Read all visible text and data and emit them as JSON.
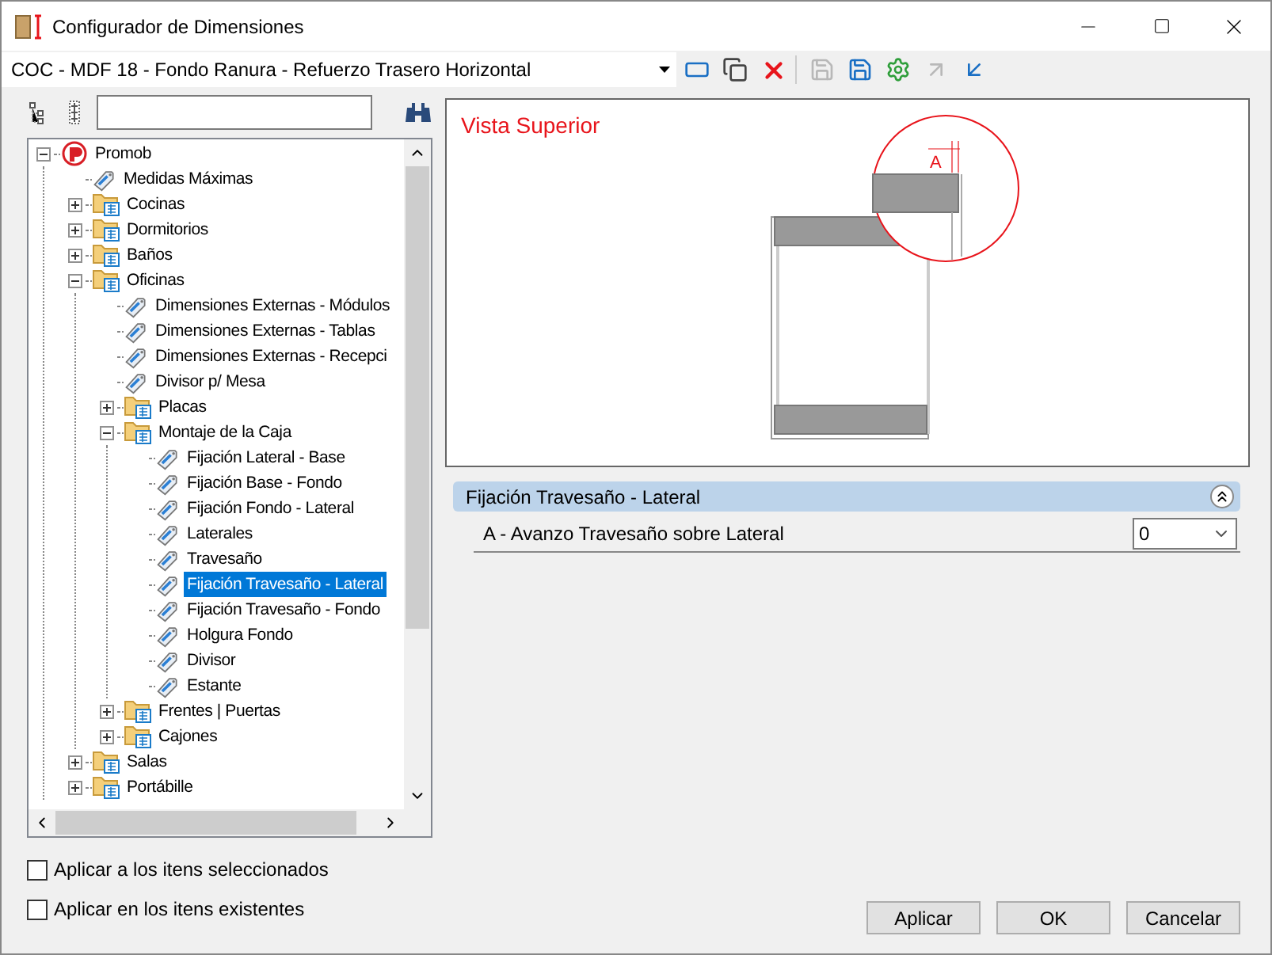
{
  "window": {
    "title": "Configurador de Dimensiones"
  },
  "toolbar": {
    "configuration": "COC - MDF 18 - Fondo Ranura - Refuerzo Trasero Horizontal",
    "buttons": [
      {
        "kind": "insert",
        "disabled": false
      },
      {
        "kind": "copy",
        "disabled": false
      },
      {
        "kind": "delete",
        "disabled": false
      },
      {
        "kind": "save",
        "disabled": true
      },
      {
        "kind": "save-as",
        "disabled": false
      },
      {
        "kind": "apply",
        "disabled": false
      },
      {
        "kind": "export",
        "disabled": true
      },
      {
        "kind": "import",
        "disabled": false
      }
    ]
  },
  "tree": [
    {
      "label": "Promob",
      "kind": "root",
      "expanded": true,
      "selected": false,
      "children": [
        {
          "label": "Medidas Máximas",
          "kind": "leaf",
          "selected": false
        },
        {
          "label": "Cocinas",
          "kind": "folder",
          "expanded": false,
          "selected": false
        },
        {
          "label": "Dormitorios",
          "kind": "folder",
          "expanded": false,
          "selected": false
        },
        {
          "label": "Baños",
          "kind": "folder",
          "expanded": false,
          "selected": false
        },
        {
          "label": "Oficinas",
          "kind": "folder",
          "expanded": true,
          "selected": false,
          "children": [
            {
              "label": "Dimensiones Externas - Módulos",
              "kind": "leaf",
              "selected": false
            },
            {
              "label": "Dimensiones Externas - Tablas",
              "kind": "leaf",
              "selected": false
            },
            {
              "label": "Dimensiones Externas - Recepci",
              "kind": "leaf",
              "selected": false
            },
            {
              "label": "Divisor p/ Mesa",
              "kind": "leaf",
              "selected": false
            },
            {
              "label": "Placas",
              "kind": "folder",
              "expanded": false,
              "selected": false
            },
            {
              "label": "Montaje de la Caja",
              "kind": "folder",
              "expanded": true,
              "selected": false,
              "children": [
                {
                  "label": "Fijación Lateral - Base",
                  "kind": "leaf",
                  "selected": false
                },
                {
                  "label": "Fijación Base - Fondo",
                  "kind": "leaf",
                  "selected": false
                },
                {
                  "label": "Fijación Fondo - Lateral",
                  "kind": "leaf",
                  "selected": false
                },
                {
                  "label": "Laterales",
                  "kind": "leaf",
                  "selected": false
                },
                {
                  "label": "Travesaño",
                  "kind": "leaf",
                  "selected": false
                },
                {
                  "label": "Fijación Travesaño - Lateral",
                  "kind": "leaf",
                  "selected": true
                },
                {
                  "label": "Fijación Travesaño - Fondo",
                  "kind": "leaf",
                  "selected": false
                },
                {
                  "label": "Holgura Fondo",
                  "kind": "leaf",
                  "selected": false
                },
                {
                  "label": "Divisor",
                  "kind": "leaf",
                  "selected": false
                },
                {
                  "label": "Estante",
                  "kind": "leaf",
                  "selected": false
                }
              ]
            },
            {
              "label": "Frentes | Puertas",
              "kind": "folder",
              "expanded": false,
              "selected": false
            },
            {
              "label": "Cajones",
              "kind": "folder",
              "expanded": false,
              "selected": false
            }
          ]
        },
        {
          "label": "Salas",
          "kind": "folder",
          "expanded": false,
          "selected": false
        },
        {
          "label": "Portábille",
          "kind": "folder",
          "expanded": false,
          "selected": false
        }
      ]
    }
  ],
  "preview": {
    "title": "Vista Superior",
    "dimension_label": "A"
  },
  "properties": {
    "group": "Fijación Travesaño - Lateral",
    "expanded": true,
    "rows": [
      {
        "label": "A - Avanzo Travesaño sobre Lateral",
        "value": "0"
      }
    ]
  },
  "options": [
    {
      "label": "Aplicar a los itens seleccionados",
      "checked": false
    },
    {
      "label": "Aplicar en los itens existentes",
      "checked": false
    }
  ],
  "buttons": [
    "Aplicar",
    "OK",
    "Cancelar"
  ]
}
